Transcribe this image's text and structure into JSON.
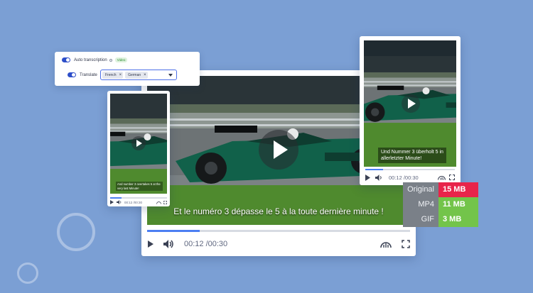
{
  "main_player": {
    "subtitle": "Et le numéro 3 dépasse le 5 à la toute dernière minute !",
    "time": "00:12 /00:30",
    "progress": 0.2
  },
  "left_player": {
    "subtitle": "And number 3 overtakes 5 at the very last Minute!",
    "time": "00:12 /00:30",
    "progress": 0.2
  },
  "right_player": {
    "subtitle": "Und Nummer 3 überholt 5 in allerletzter Minute!",
    "time": "00:12 /00:30",
    "progress": 0.2
  },
  "settings": {
    "auto_transcription_label": "Auto transcription",
    "video_badge": "Video",
    "translate_label": "Translate",
    "languages": [
      "French",
      "German"
    ]
  },
  "file_sizes": [
    {
      "label": "Original",
      "value": "15 MB",
      "color": "#e8244a"
    },
    {
      "label": "MP4",
      "value": "11 MB",
      "color": "#73c44a"
    },
    {
      "label": "GIF",
      "value": "3 MB",
      "color": "#73c44a"
    }
  ],
  "colors": {
    "background": "#7b9fd4",
    "accent": "#4c7ff2",
    "toggle_on": "#2e4fc9"
  }
}
